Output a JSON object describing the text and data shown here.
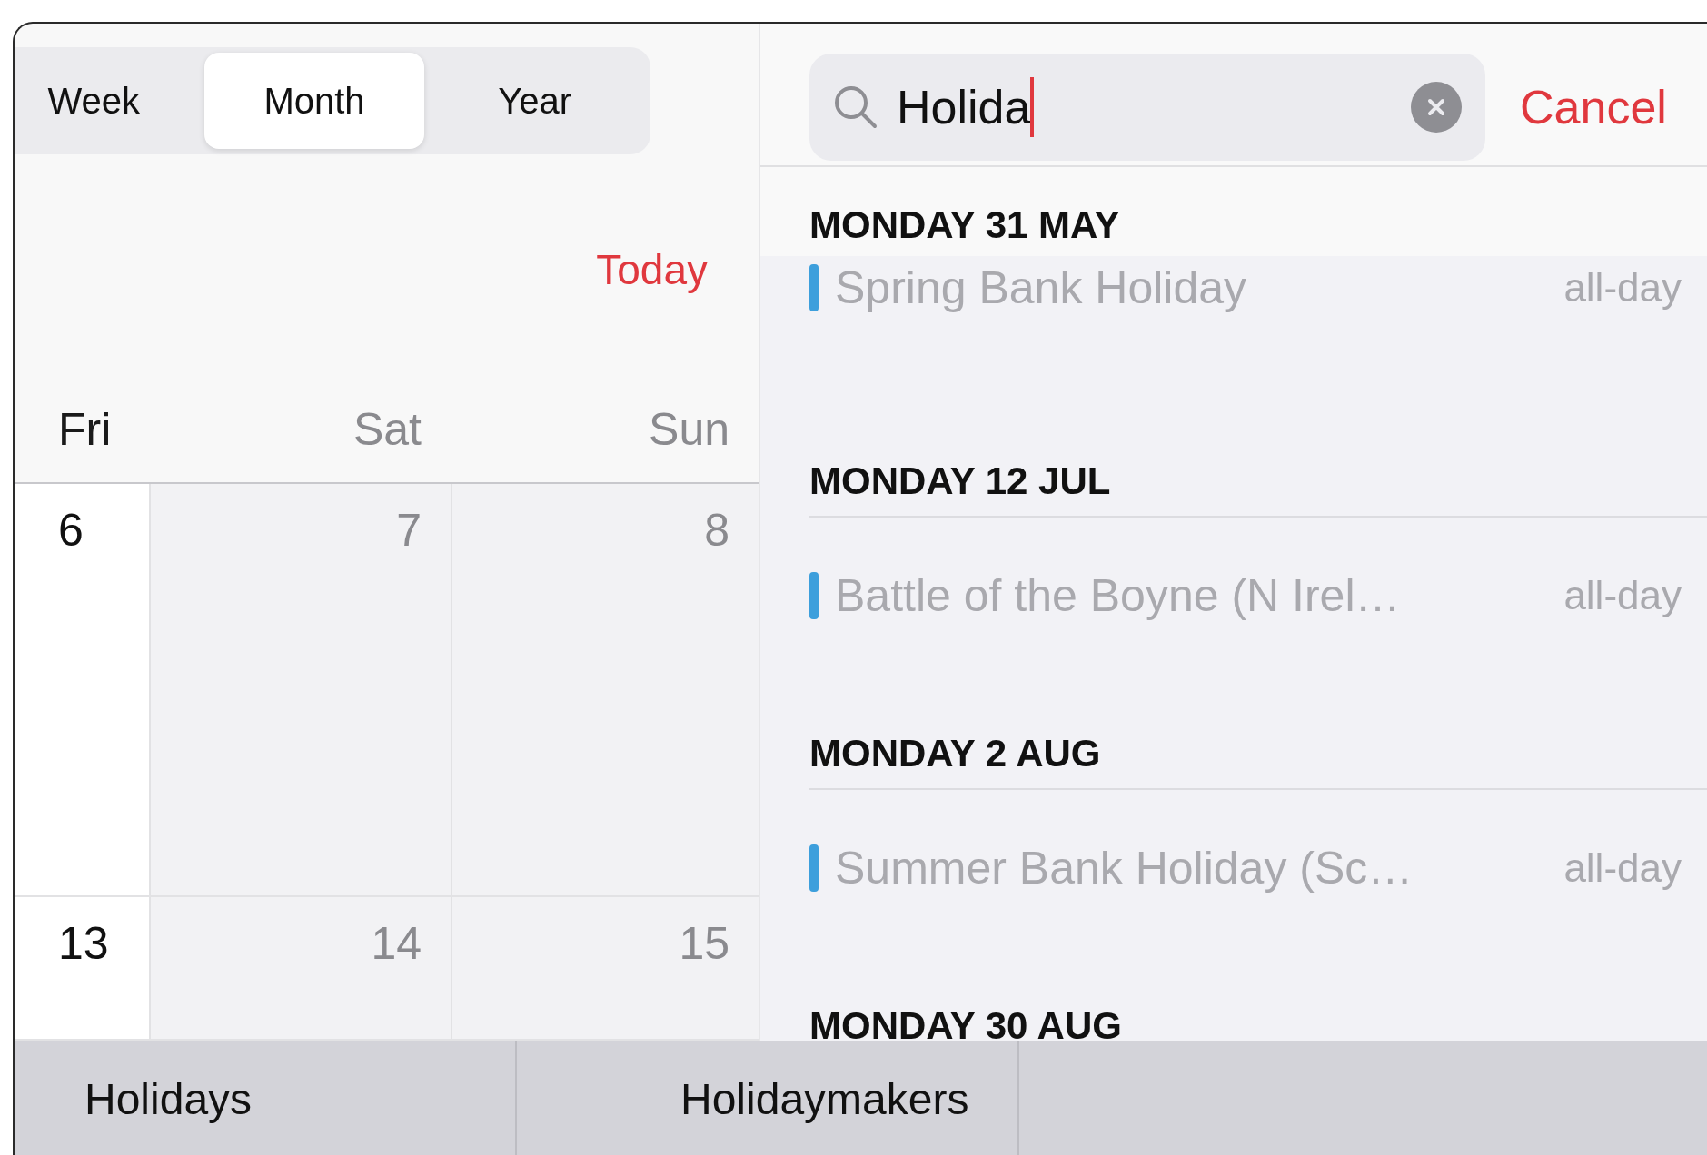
{
  "view_switcher": [
    {
      "label": "Week",
      "selected": false
    },
    {
      "label": "Month",
      "selected": true
    },
    {
      "label": "Year",
      "selected": false
    }
  ],
  "today_button": "Today",
  "calendar": {
    "columns": [
      {
        "label": "Fri",
        "weekend": false
      },
      {
        "label": "Sat",
        "weekend": true
      },
      {
        "label": "Sun",
        "weekend": true
      }
    ],
    "weeks": [
      {
        "days": [
          "6",
          "7",
          "8"
        ]
      },
      {
        "days": [
          "13",
          "14",
          "15"
        ]
      }
    ]
  },
  "search": {
    "value": "Holida",
    "cancel": "Cancel"
  },
  "results": [
    {
      "date": "MONDAY 31 MAY",
      "events": [
        {
          "title": "Spring Bank Holiday",
          "time": "all-day",
          "color": "#3d9fdc"
        }
      ]
    },
    {
      "date": "MONDAY 12 JUL",
      "events": [
        {
          "title": "Battle of the Boyne (N Irel…",
          "time": "all-day",
          "color": "#3d9fdc"
        }
      ]
    },
    {
      "date": "MONDAY 2 AUG",
      "events": [
        {
          "title": "Summer Bank Holiday (Sc…",
          "time": "all-day",
          "color": "#3d9fdc"
        }
      ]
    },
    {
      "date": "MONDAY 30 AUG"
    }
  ],
  "suggestions": [
    "Holidays",
    "Holidaymakers"
  ]
}
